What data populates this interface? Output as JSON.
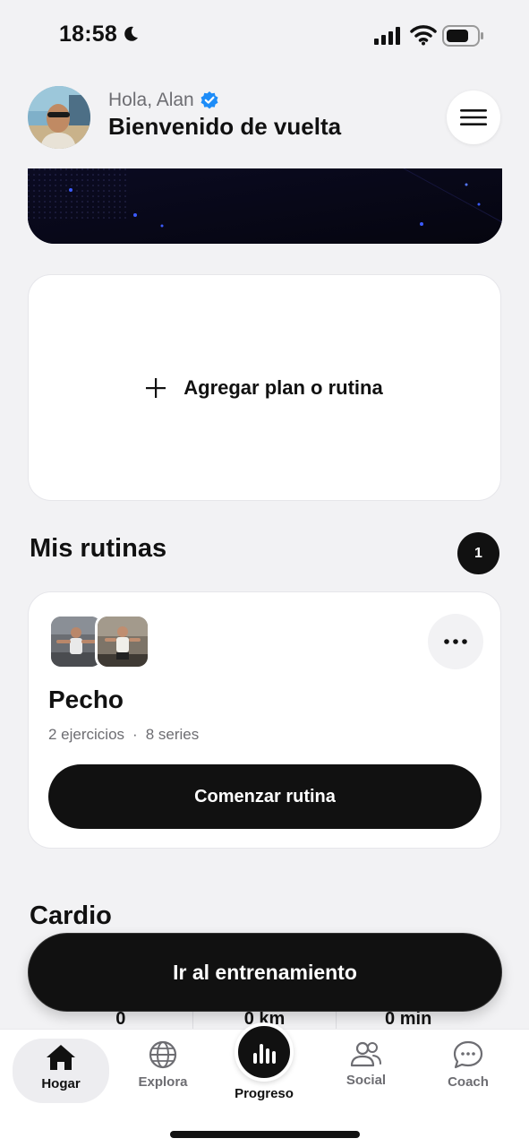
{
  "status_bar": {
    "time": "18:58"
  },
  "header": {
    "greeting": "Hola, Alan",
    "welcome": "Bienvenido de vuelta"
  },
  "add_plan": {
    "label": "Agregar plan o rutina"
  },
  "my_routines": {
    "title": "Mis rutinas",
    "count": "1",
    "routine": {
      "name": "Pecho",
      "exercises": "2 ejercicios",
      "separator": "·",
      "series": "8 series",
      "start_label": "Comenzar rutina"
    }
  },
  "cardio": {
    "title": "Cardio",
    "stats": [
      "0",
      "0 km",
      "0 min"
    ]
  },
  "cta": {
    "label": "Ir al entrenamiento"
  },
  "bottom_nav": {
    "items": [
      {
        "label": "Hogar",
        "icon": "home-icon",
        "active": true
      },
      {
        "label": "Explora",
        "icon": "globe-icon"
      },
      {
        "label": "Progreso",
        "icon": "bar-chart-icon"
      },
      {
        "label": "Social",
        "icon": "users-icon"
      },
      {
        "label": "Coach",
        "icon": "chat-icon"
      }
    ]
  },
  "colors": {
    "background": "#f2f2f4",
    "primary": "#111111",
    "verified": "#1d8cf8"
  }
}
